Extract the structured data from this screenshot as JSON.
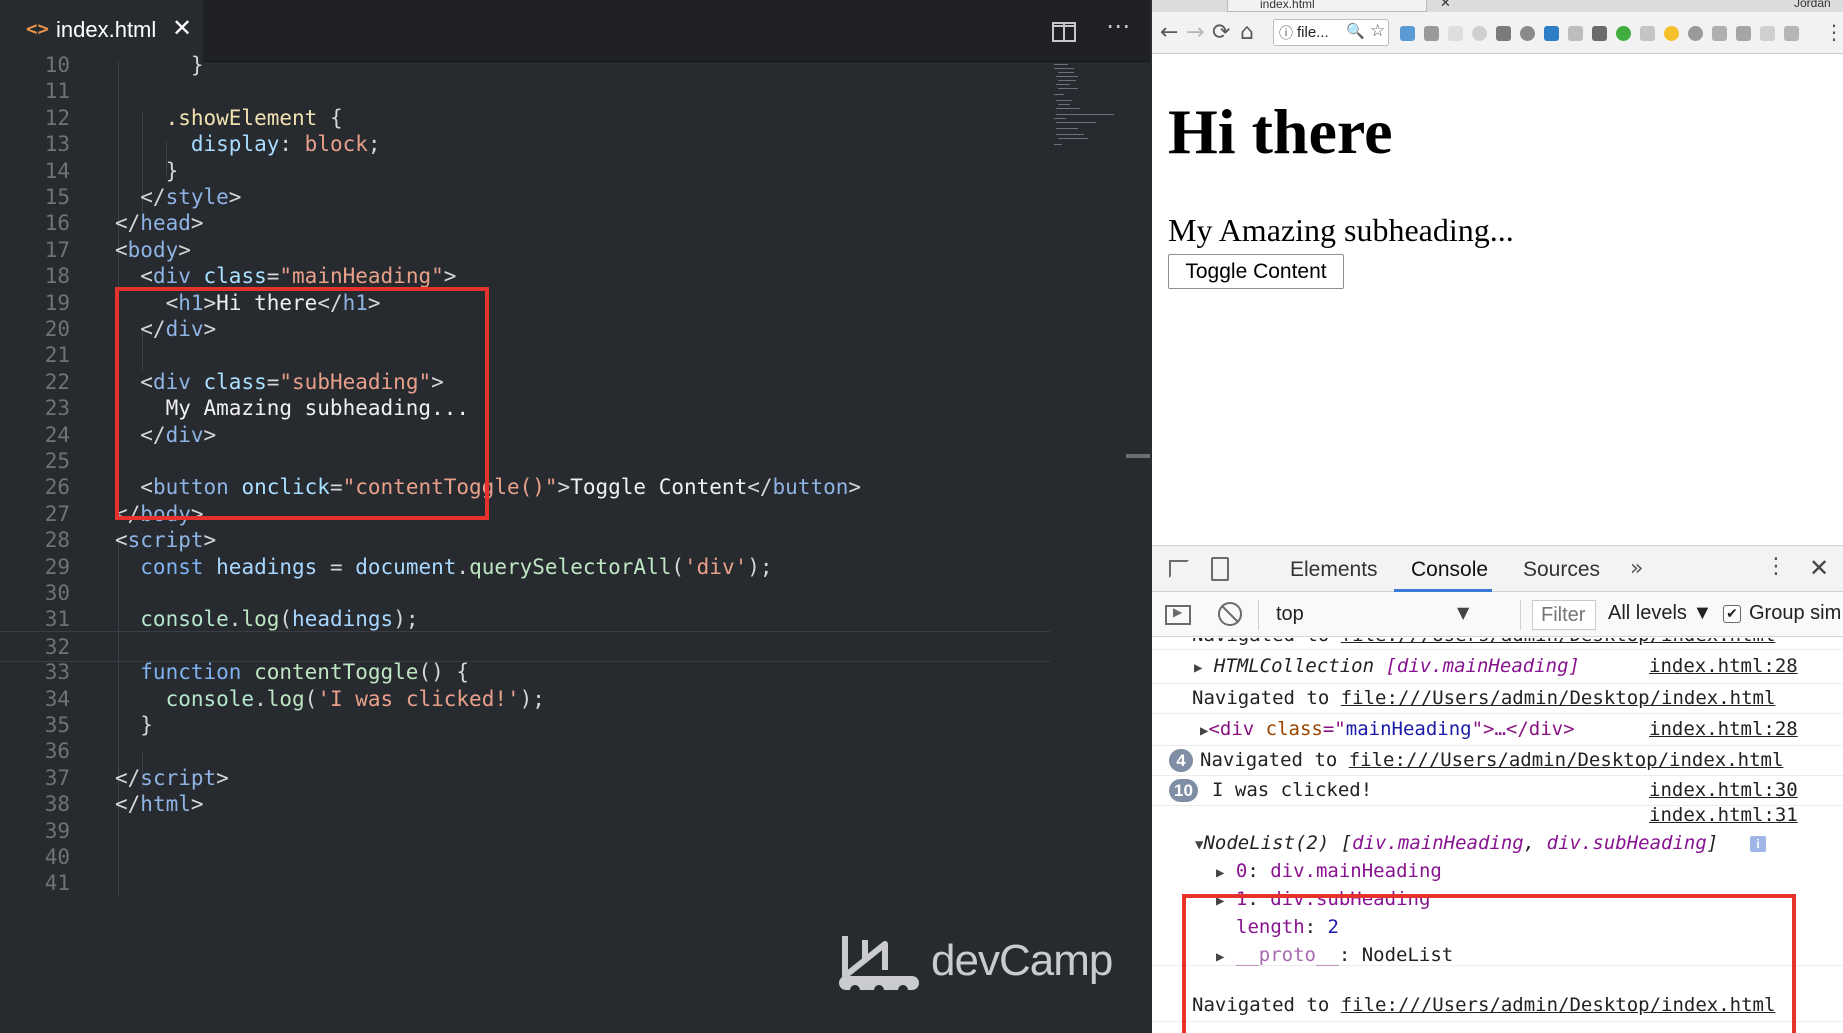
{
  "editor": {
    "tab": {
      "code_icon": "<>",
      "title": "index.html",
      "close": "✕"
    },
    "split_icon": "split-editor-icon",
    "more_icon": "⋯",
    "lines": [
      {
        "n": "10",
        "tokens": [
          {
            "t": "      }",
            "c": "t-punc"
          }
        ]
      },
      {
        "n": "11",
        "tokens": []
      },
      {
        "n": "12",
        "tokens": [
          {
            "t": "    .showElement",
            "c": "t-sel"
          },
          {
            "t": " {",
            "c": "t-punc"
          }
        ]
      },
      {
        "n": "13",
        "tokens": [
          {
            "t": "      display",
            "c": "t-prop"
          },
          {
            "t": ": ",
            "c": "t-punc"
          },
          {
            "t": "block",
            "c": "t-val"
          },
          {
            "t": ";",
            "c": "t-punc"
          }
        ]
      },
      {
        "n": "14",
        "tokens": [
          {
            "t": "    }",
            "c": "t-punc"
          }
        ]
      },
      {
        "n": "15",
        "tokens": [
          {
            "t": "  </",
            "c": "t-punc"
          },
          {
            "t": "style",
            "c": "t-tag"
          },
          {
            "t": ">",
            "c": "t-punc"
          }
        ]
      },
      {
        "n": "16",
        "tokens": [
          {
            "t": "</",
            "c": "t-punc"
          },
          {
            "t": "head",
            "c": "t-tag"
          },
          {
            "t": ">",
            "c": "t-punc"
          }
        ]
      },
      {
        "n": "17",
        "tokens": [
          {
            "t": "<",
            "c": "t-punc"
          },
          {
            "t": "body",
            "c": "t-tag"
          },
          {
            "t": ">",
            "c": "t-punc"
          }
        ]
      },
      {
        "n": "18",
        "tokens": [
          {
            "t": "  <",
            "c": "t-punc"
          },
          {
            "t": "div",
            "c": "t-tag"
          },
          {
            "t": " class",
            "c": "t-attr"
          },
          {
            "t": "=",
            "c": "t-punc"
          },
          {
            "t": "\"mainHeading\"",
            "c": "t-str"
          },
          {
            "t": ">",
            "c": "t-punc"
          }
        ]
      },
      {
        "n": "19",
        "tokens": [
          {
            "t": "    <",
            "c": "t-punc"
          },
          {
            "t": "h1",
            "c": "t-tag"
          },
          {
            "t": ">",
            "c": "t-punc"
          },
          {
            "t": "Hi there",
            "c": "t-text"
          },
          {
            "t": "</",
            "c": "t-punc"
          },
          {
            "t": "h1",
            "c": "t-tag"
          },
          {
            "t": ">",
            "c": "t-punc"
          }
        ]
      },
      {
        "n": "20",
        "tokens": [
          {
            "t": "  </",
            "c": "t-punc"
          },
          {
            "t": "div",
            "c": "t-tag"
          },
          {
            "t": ">",
            "c": "t-punc"
          }
        ]
      },
      {
        "n": "21",
        "tokens": []
      },
      {
        "n": "22",
        "tokens": [
          {
            "t": "  <",
            "c": "t-punc"
          },
          {
            "t": "div",
            "c": "t-tag"
          },
          {
            "t": " class",
            "c": "t-attr"
          },
          {
            "t": "=",
            "c": "t-punc"
          },
          {
            "t": "\"subHeading\"",
            "c": "t-str"
          },
          {
            "t": ">",
            "c": "t-punc"
          }
        ]
      },
      {
        "n": "23",
        "tokens": [
          {
            "t": "    My Amazing subheading...",
            "c": "t-text"
          }
        ]
      },
      {
        "n": "24",
        "tokens": [
          {
            "t": "  </",
            "c": "t-punc"
          },
          {
            "t": "div",
            "c": "t-tag"
          },
          {
            "t": ">",
            "c": "t-punc"
          }
        ]
      },
      {
        "n": "25",
        "tokens": []
      },
      {
        "n": "26",
        "tokens": [
          {
            "t": "  <",
            "c": "t-punc"
          },
          {
            "t": "button",
            "c": "t-tag"
          },
          {
            "t": " onclick",
            "c": "t-attr"
          },
          {
            "t": "=",
            "c": "t-punc"
          },
          {
            "t": "\"contentToggle()\"",
            "c": "t-str"
          },
          {
            "t": ">",
            "c": "t-punc"
          },
          {
            "t": "Toggle Content",
            "c": "t-text"
          },
          {
            "t": "</",
            "c": "t-punc"
          },
          {
            "t": "button",
            "c": "t-tag"
          },
          {
            "t": ">",
            "c": "t-punc"
          }
        ]
      },
      {
        "n": "27",
        "tokens": [
          {
            "t": "</",
            "c": "t-punc"
          },
          {
            "t": "body",
            "c": "t-tag"
          },
          {
            "t": ">",
            "c": "t-punc"
          }
        ]
      },
      {
        "n": "28",
        "tokens": [
          {
            "t": "<",
            "c": "t-punc"
          },
          {
            "t": "script",
            "c": "t-tag"
          },
          {
            "t": ">",
            "c": "t-punc"
          }
        ]
      },
      {
        "n": "29",
        "tokens": [
          {
            "t": "  const",
            "c": "t-kw"
          },
          {
            "t": " headings",
            "c": "t-var"
          },
          {
            "t": " = ",
            "c": "t-punc"
          },
          {
            "t": "document",
            "c": "t-var"
          },
          {
            "t": ".",
            "c": "t-punc"
          },
          {
            "t": "querySelectorAll",
            "c": "t-fn"
          },
          {
            "t": "(",
            "c": "t-punc"
          },
          {
            "t": "'div'",
            "c": "t-str"
          },
          {
            "t": ");",
            "c": "t-punc"
          }
        ]
      },
      {
        "n": "30",
        "tokens": []
      },
      {
        "n": "31",
        "tokens": [
          {
            "t": "  console",
            "c": "t-obj"
          },
          {
            "t": ".",
            "c": "t-punc"
          },
          {
            "t": "log",
            "c": "t-fn"
          },
          {
            "t": "(",
            "c": "t-punc"
          },
          {
            "t": "headings",
            "c": "t-var"
          },
          {
            "t": ");",
            "c": "t-punc"
          }
        ]
      },
      {
        "n": "32",
        "tokens": [],
        "current": true
      },
      {
        "n": "33",
        "tokens": [
          {
            "t": "  function",
            "c": "t-kw"
          },
          {
            "t": " contentToggle",
            "c": "t-fn"
          },
          {
            "t": "() {",
            "c": "t-punc"
          }
        ]
      },
      {
        "n": "34",
        "tokens": [
          {
            "t": "    console",
            "c": "t-obj"
          },
          {
            "t": ".",
            "c": "t-punc"
          },
          {
            "t": "log",
            "c": "t-fn"
          },
          {
            "t": "(",
            "c": "t-punc"
          },
          {
            "t": "'I was clicked!'",
            "c": "t-str"
          },
          {
            "t": ");",
            "c": "t-punc"
          }
        ]
      },
      {
        "n": "35",
        "tokens": [
          {
            "t": "  }",
            "c": "t-punc"
          }
        ]
      },
      {
        "n": "36",
        "tokens": []
      },
      {
        "n": "37",
        "tokens": [
          {
            "t": "</",
            "c": "t-punc"
          },
          {
            "t": "script",
            "c": "t-tag"
          },
          {
            "t": ">",
            "c": "t-punc"
          }
        ]
      },
      {
        "n": "38",
        "tokens": [
          {
            "t": "</",
            "c": "t-punc"
          },
          {
            "t": "html",
            "c": "t-tag"
          },
          {
            "t": ">",
            "c": "t-punc"
          }
        ]
      },
      {
        "n": "39",
        "tokens": []
      },
      {
        "n": "40",
        "tokens": []
      },
      {
        "n": "41",
        "tokens": []
      }
    ],
    "watermark": "devCamp"
  },
  "browser": {
    "tab_title": "index.html",
    "tab_close": "✕",
    "profile_name": "Jordan",
    "nav": {
      "back": "←",
      "forward": "→",
      "reload": "⟳",
      "home": "⌂"
    },
    "omnibox": {
      "info_icon": "ⓘ",
      "text": "file...",
      "zoom_icon": "🔍",
      "star_icon": "☆"
    },
    "menu_icon": "⋮",
    "page": {
      "h1": "Hi there",
      "subheading": "My Amazing subheading...",
      "button": "Toggle Content"
    }
  },
  "devtools": {
    "tabs": {
      "elements": "Elements",
      "console": "Console",
      "sources": "Sources",
      "more": "»"
    },
    "kebab": "⋮",
    "close": "✕",
    "toolbar": {
      "context": "top",
      "context_caret": "▼",
      "filter_placeholder": "Filter",
      "levels": "All levels ▼",
      "group_check": "✔",
      "group_label": "Group sim"
    },
    "messages": {
      "m0": {
        "text": "Navigated to ",
        "url": "file:///Users/admin/Desktop/index.html"
      },
      "m1": {
        "tri": "▶",
        "text": "HTMLCollection ",
        "detail": "[div.mainHeading]",
        "link": "index.html:28"
      },
      "m2": {
        "text": "Navigated to ",
        "url": "file:///Users/admin/Desktop/index.html"
      },
      "m3": {
        "tri": "▶",
        "lt": "<",
        "tag": "div",
        "attr": " class",
        "eq": "=\"",
        "val": "mainHeading",
        "close": "\">…</",
        "tag2": "div",
        "gt": ">",
        "link": "index.html:28"
      },
      "m4": {
        "badge": "4",
        "text": "Navigated to ",
        "url": "file:///Users/admin/Desktop/index.html"
      },
      "m5": {
        "badge": "10",
        "text": "I was clicked!",
        "link": "index.html:30"
      },
      "m6": {
        "link": "index.html:31"
      },
      "nodelist": {
        "tri": "▼",
        "head": "NodeList(2) [",
        "item1": "div.mainHeading",
        "sep": ", ",
        "item2": "div.subHeading",
        "tail": "]",
        "info": "i",
        "r0": {
          "tri": "▶",
          "key": "0",
          "val": "div.mainHeading"
        },
        "r1": {
          "tri": "▶",
          "key": "1",
          "val": "div.subHeading"
        },
        "r2": {
          "key": "length",
          "val": "2"
        },
        "r3": {
          "tri": "▶",
          "key": "__proto__",
          "val": "NodeList"
        }
      },
      "m7": {
        "text": "Navigated to ",
        "url": "file:///Users/admin/Desktop/index.html"
      }
    }
  },
  "colors": {
    "annotation_red": "#e5322d",
    "editor_bg": "#272a2f",
    "devtools_accent": "#3879d9"
  }
}
